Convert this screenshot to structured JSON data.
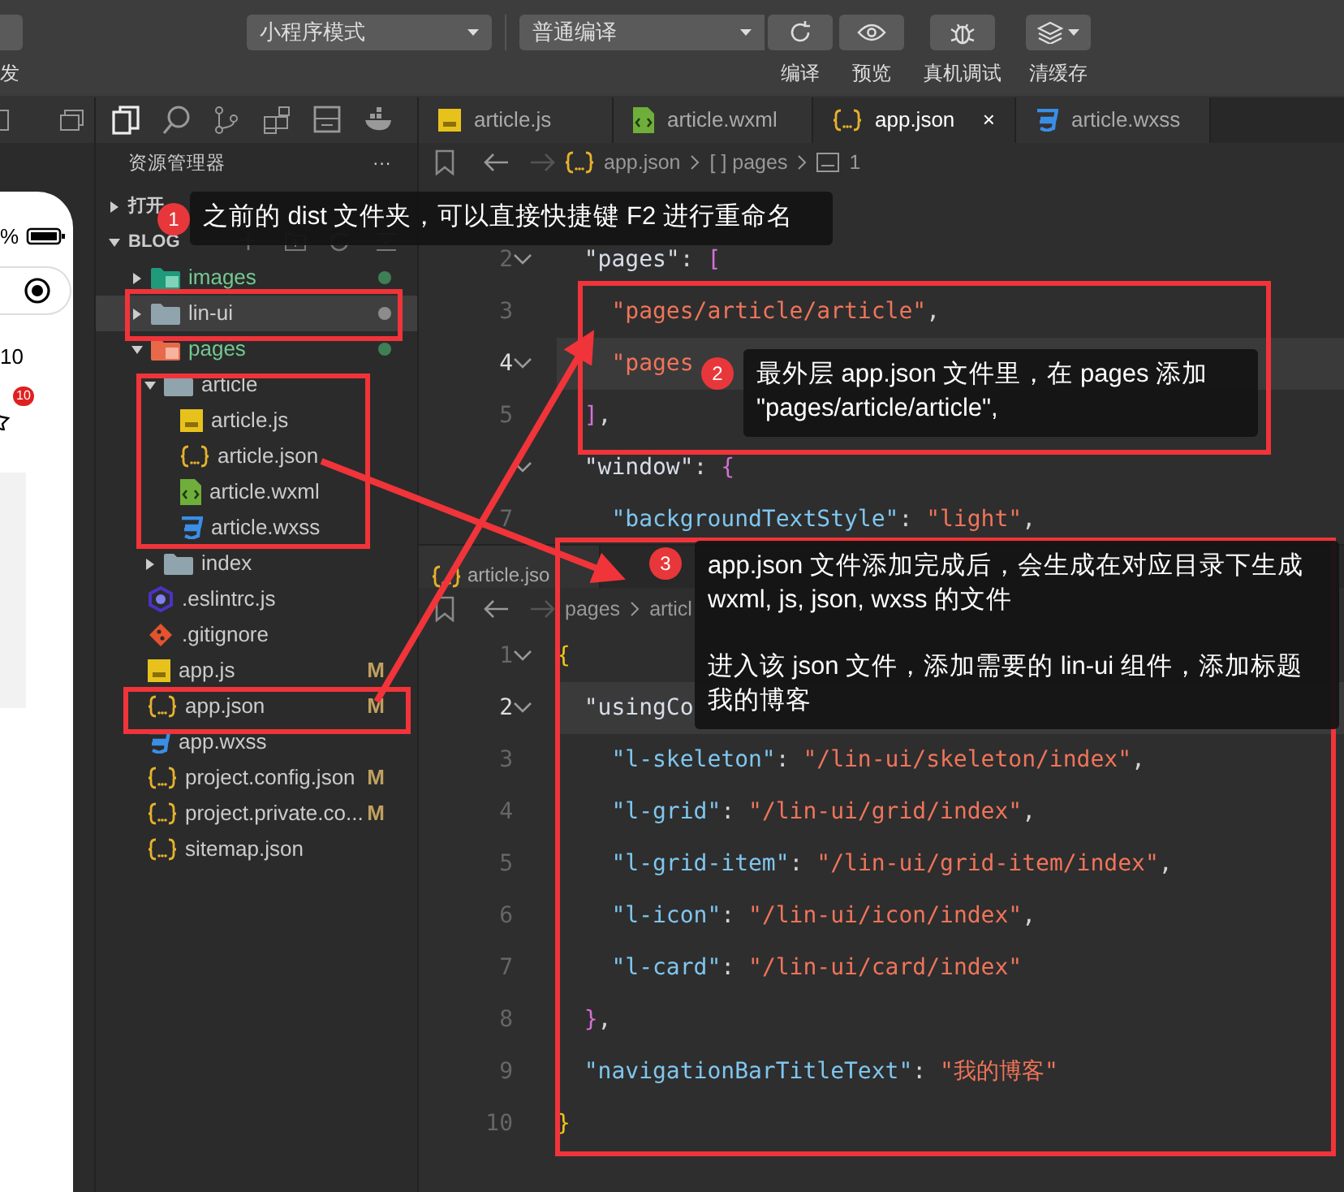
{
  "toolbar": {
    "cut_label": "发",
    "mode_select": "小程序模式",
    "compile_select": "普通编译",
    "buttons": [
      {
        "label": "编译",
        "has_menu": false
      },
      {
        "label": "预览",
        "has_menu": false
      },
      {
        "label": "真机调试",
        "has_menu": false
      },
      {
        "label": "清缓存",
        "has_menu": true
      }
    ]
  },
  "simulator": {
    "battery_text": "%",
    "count": "10",
    "star_badge": "10"
  },
  "explorer": {
    "title": "资源管理器",
    "more": "···",
    "open_editors": "打开",
    "root": "BLOG",
    "tree": [
      {
        "name": "images",
        "kind": "images-folder",
        "expanded": false,
        "untracked": true,
        "selected": false,
        "color": "#3f7f56"
      },
      {
        "name": "lin-ui",
        "kind": "folder",
        "expanded": false,
        "untracked": false,
        "selected": true,
        "color": "#8c8c8c"
      },
      {
        "name": "pages",
        "kind": "pages-folder",
        "expanded": true,
        "untracked": true,
        "selected": false,
        "color": "#3f7f56",
        "children": [
          {
            "name": "article",
            "kind": "folder",
            "expanded": true,
            "untracked": false,
            "selected": false,
            "children": [
              {
                "name": "article.js",
                "kind": "js",
                "untracked": false,
                "selected": false
              },
              {
                "name": "article.json",
                "kind": "json",
                "untracked": false,
                "selected": false
              },
              {
                "name": "article.wxml",
                "kind": "wxml",
                "untracked": false,
                "selected": false
              },
              {
                "name": "article.wxss",
                "kind": "wxss",
                "untracked": false,
                "selected": false
              }
            ]
          },
          {
            "name": "index",
            "kind": "folder",
            "expanded": false,
            "untracked": false,
            "selected": false
          }
        ]
      },
      {
        "name": ".eslintrc.js",
        "kind": "eslint",
        "untracked": false,
        "selected": false
      },
      {
        "name": ".gitignore",
        "kind": "git",
        "untracked": false,
        "selected": false
      },
      {
        "name": "app.js",
        "kind": "js",
        "untracked": false,
        "selected": false,
        "badge": "M"
      },
      {
        "name": "app.json",
        "kind": "json",
        "untracked": false,
        "selected": false,
        "badge": "M"
      },
      {
        "name": "app.wxss",
        "kind": "wxss",
        "untracked": false,
        "selected": false
      },
      {
        "name": "project.config.json",
        "kind": "json",
        "untracked": false,
        "selected": false,
        "badge": "M"
      },
      {
        "name": "project.private.co...",
        "kind": "json",
        "untracked": false,
        "selected": false,
        "badge": "M"
      },
      {
        "name": "sitemap.json",
        "kind": "json",
        "untracked": false,
        "selected": false
      }
    ]
  },
  "editor": {
    "tabs": [
      {
        "kind": "js",
        "label": "article.js",
        "selected": false
      },
      {
        "kind": "wxml",
        "label": "article.wxml",
        "selected": false
      },
      {
        "kind": "json",
        "label": "app.json",
        "selected": true,
        "close": "×"
      },
      {
        "kind": "wxss",
        "label": "article.wxss",
        "selected": false
      }
    ],
    "breadcrumb": [
      "app.json",
      "[ ] pages",
      "1"
    ],
    "lines": [
      {
        "number": "2",
        "active": false,
        "tokens": [
          {
            "kind": "key",
            "text": "  \"pages\""
          },
          {
            "kind": "punct",
            "text": ": "
          },
          {
            "kind": "bracket",
            "text": "["
          }
        ]
      },
      {
        "number": "3",
        "active": false,
        "tokens": [
          {
            "kind": "string",
            "text": "    \"pages/article/article\""
          },
          {
            "kind": "punct",
            "text": ","
          }
        ]
      },
      {
        "number": "4",
        "active": true,
        "tokens": [
          {
            "kind": "string",
            "text": "    \"pages"
          }
        ]
      },
      {
        "number": "5",
        "active": false,
        "tokens": [
          {
            "kind": "bracket",
            "text": "  ]"
          },
          {
            "kind": "punct",
            "text": ","
          }
        ]
      },
      {
        "active": false,
        "tokens": [
          {
            "kind": "key",
            "text": "  \"window\""
          },
          {
            "kind": "punct",
            "text": ": "
          },
          {
            "kind": "bracket",
            "text": "{"
          }
        ]
      },
      {
        "number": "7",
        "active": false,
        "tokens": [
          {
            "kind": "subkey",
            "text": "    \"backgroundTextStyle\""
          },
          {
            "kind": "punct",
            "text": ": "
          },
          {
            "kind": "string",
            "text": "\"light\""
          },
          {
            "kind": "punct",
            "text": ","
          }
        ]
      }
    ]
  },
  "split_editor": {
    "tab": {
      "kind": "json",
      "label": "article.jso"
    },
    "breadcrumb": [
      "pages",
      "articl"
    ],
    "lines": [
      {
        "number": "1",
        "active": false,
        "tokens": [
          {
            "kind": "brace",
            "text": "{"
          }
        ]
      },
      {
        "number": "2",
        "active": true,
        "tokens": [
          {
            "kind": "key",
            "text": "  \"usingCo"
          }
        ]
      },
      {
        "number": "3",
        "active": false,
        "tokens": [
          {
            "kind": "subkey",
            "text": "    \"l-skeleton\""
          },
          {
            "kind": "punct",
            "text": ": "
          },
          {
            "kind": "string",
            "text": "\"/lin-ui/skeleton/index\""
          },
          {
            "kind": "punct",
            "text": ","
          }
        ]
      },
      {
        "number": "4",
        "active": false,
        "tokens": [
          {
            "kind": "subkey",
            "text": "    \"l-grid\""
          },
          {
            "kind": "punct",
            "text": ": "
          },
          {
            "kind": "string",
            "text": "\"/lin-ui/grid/index\""
          },
          {
            "kind": "punct",
            "text": ","
          }
        ]
      },
      {
        "number": "5",
        "active": false,
        "tokens": [
          {
            "kind": "subkey",
            "text": "    \"l-grid-item\""
          },
          {
            "kind": "punct",
            "text": ": "
          },
          {
            "kind": "string",
            "text": "\"/lin-ui/grid-item/index\""
          },
          {
            "kind": "punct",
            "text": ","
          }
        ]
      },
      {
        "number": "6",
        "active": false,
        "tokens": [
          {
            "kind": "subkey",
            "text": "    \"l-icon\""
          },
          {
            "kind": "punct",
            "text": ": "
          },
          {
            "kind": "string",
            "text": "\"/lin-ui/icon/index\""
          },
          {
            "kind": "punct",
            "text": ","
          }
        ]
      },
      {
        "number": "7",
        "active": false,
        "tokens": [
          {
            "kind": "subkey",
            "text": "    \"l-card\""
          },
          {
            "kind": "punct",
            "text": ": "
          },
          {
            "kind": "string",
            "text": "\"/lin-ui/card/index\""
          }
        ]
      },
      {
        "number": "8",
        "active": false,
        "tokens": [
          {
            "kind": "bracket",
            "text": "  }"
          },
          {
            "kind": "punct",
            "text": ","
          }
        ]
      },
      {
        "number": "9",
        "active": false,
        "tokens": [
          {
            "kind": "subkey",
            "text": "  \"navigationBarTitleText\""
          },
          {
            "kind": "punct",
            "text": ": "
          },
          {
            "kind": "string",
            "text": "\"我的博客\""
          }
        ]
      },
      {
        "number": "10",
        "active": false,
        "tokens": [
          {
            "kind": "brace",
            "text": "}"
          }
        ]
      }
    ]
  },
  "annotations": [
    {
      "number": "1",
      "texts": [
        "之前的 dist 文件夹，可以直接快捷键 F2 进行重命名"
      ]
    },
    {
      "number": "2",
      "texts": [
        "最外层 app.json 文件里，在 pages 添加 \"pages/article/article\","
      ]
    },
    {
      "number": "3",
      "texts": [
        "app.json 文件添加完成后，会生成在对应目录下生成 wxml, js, json, wxss 的文件",
        "进入该 json 文件，添加需要的 lin-ui 组件，添加标题我的博客"
      ]
    }
  ]
}
